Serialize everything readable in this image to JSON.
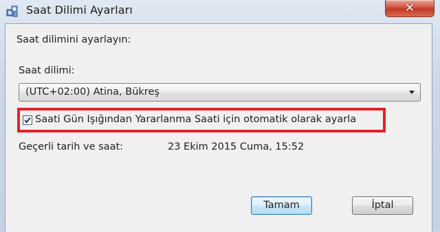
{
  "window": {
    "title": "Saat Dilimi Ayarları",
    "title_icon": "clock-settings-icon",
    "close_glyph": "✕"
  },
  "form": {
    "instruction": "Saat dilimini ayarlayın:",
    "timezone_label": "Saat dilimi:",
    "timezone_value": "(UTC+02:00) Atina, Bükreş",
    "dst_checkbox_label": "Saati Gün Işığından Yararlanma Saati için otomatik olarak ayarla",
    "dst_checked": true,
    "current_datetime_label": "Geçerli tarih ve saat:",
    "current_datetime_value": "23 Ekim 2015 Cuma, 15:52"
  },
  "buttons": {
    "ok_label": "Tamam",
    "cancel_label": "İptal"
  },
  "colors": {
    "highlight": "#e2232a",
    "close_button": "#c23a26"
  }
}
